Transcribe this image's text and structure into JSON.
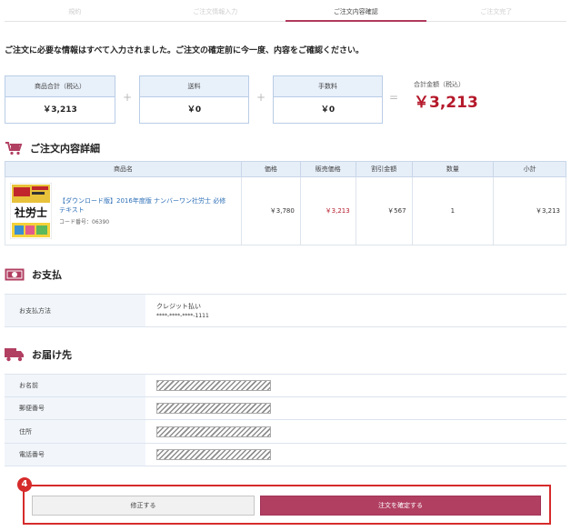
{
  "steps": [
    "規約",
    "ご注文情報入力",
    "ご注文内容確認",
    "ご注文完了"
  ],
  "intro": "ご注文に必要な情報はすべて入力されました。ご注文の確定前に今一度、内容をご確認ください。",
  "totals": {
    "subtotal_label": "商品合計（税込）",
    "subtotal_value": "￥3,213",
    "shipping_label": "送料",
    "shipping_value": "￥0",
    "fee_label": "手数料",
    "fee_value": "￥0",
    "plus": "+",
    "equals": "=",
    "grand_label": "合計金額（税込）",
    "grand_value": "￥3,213"
  },
  "order": {
    "title": "ご注文内容詳細",
    "columns": [
      "商品名",
      "価格",
      "販売価格",
      "割引金額",
      "数量",
      "小計"
    ],
    "item": {
      "name": "【ダウンロード版】2016年度版 ナンバーワン社労士 必修テキスト",
      "code": "コード番号：06390",
      "price": "￥3,780",
      "sale_price": "￥3,213",
      "discount": "￥567",
      "qty": "1",
      "subtotal": "￥3,213",
      "cover_text": "社労士"
    }
  },
  "payment": {
    "title": "お支払",
    "label": "お支払方法",
    "method": "クレジット払い",
    "card": "****-****-****-1111"
  },
  "delivery": {
    "title": "お届け先",
    "rows": [
      "お名前",
      "郵便番号",
      "住所",
      "電話番号"
    ]
  },
  "buttons": {
    "badge": "4",
    "edit": "修正する",
    "confirm": "注文を確定する"
  },
  "colors": {
    "accent": "#b13f62",
    "price_red": "#b5192b",
    "header_blue": "#e6eef8"
  }
}
